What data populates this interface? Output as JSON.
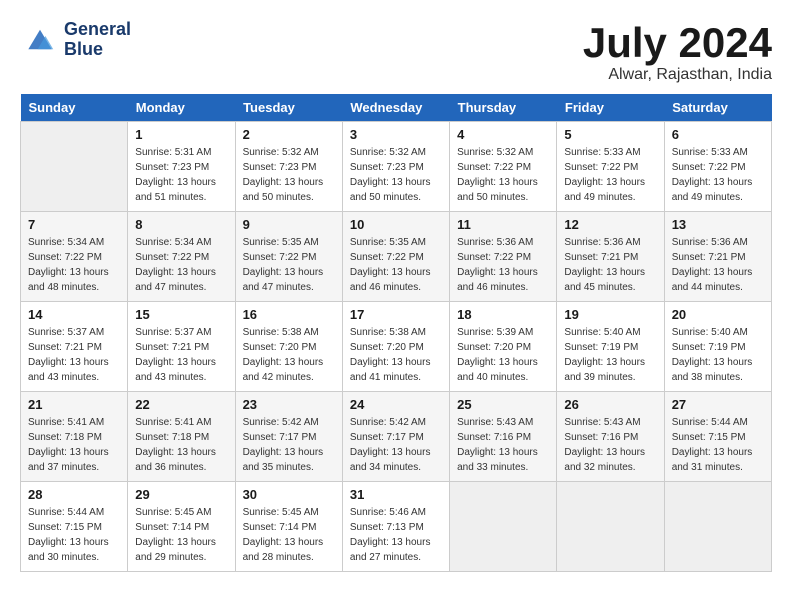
{
  "header": {
    "logo_line1": "General",
    "logo_line2": "Blue",
    "month": "July 2024",
    "location": "Alwar, Rajasthan, India"
  },
  "days_of_week": [
    "Sunday",
    "Monday",
    "Tuesday",
    "Wednesday",
    "Thursday",
    "Friday",
    "Saturday"
  ],
  "weeks": [
    [
      {
        "day": "",
        "sunrise": "",
        "sunset": "",
        "daylight": ""
      },
      {
        "day": "1",
        "sunrise": "Sunrise: 5:31 AM",
        "sunset": "Sunset: 7:23 PM",
        "daylight": "Daylight: 13 hours and 51 minutes."
      },
      {
        "day": "2",
        "sunrise": "Sunrise: 5:32 AM",
        "sunset": "Sunset: 7:23 PM",
        "daylight": "Daylight: 13 hours and 50 minutes."
      },
      {
        "day": "3",
        "sunrise": "Sunrise: 5:32 AM",
        "sunset": "Sunset: 7:23 PM",
        "daylight": "Daylight: 13 hours and 50 minutes."
      },
      {
        "day": "4",
        "sunrise": "Sunrise: 5:32 AM",
        "sunset": "Sunset: 7:22 PM",
        "daylight": "Daylight: 13 hours and 50 minutes."
      },
      {
        "day": "5",
        "sunrise": "Sunrise: 5:33 AM",
        "sunset": "Sunset: 7:22 PM",
        "daylight": "Daylight: 13 hours and 49 minutes."
      },
      {
        "day": "6",
        "sunrise": "Sunrise: 5:33 AM",
        "sunset": "Sunset: 7:22 PM",
        "daylight": "Daylight: 13 hours and 49 minutes."
      }
    ],
    [
      {
        "day": "7",
        "sunrise": "Sunrise: 5:34 AM",
        "sunset": "Sunset: 7:22 PM",
        "daylight": "Daylight: 13 hours and 48 minutes."
      },
      {
        "day": "8",
        "sunrise": "Sunrise: 5:34 AM",
        "sunset": "Sunset: 7:22 PM",
        "daylight": "Daylight: 13 hours and 47 minutes."
      },
      {
        "day": "9",
        "sunrise": "Sunrise: 5:35 AM",
        "sunset": "Sunset: 7:22 PM",
        "daylight": "Daylight: 13 hours and 47 minutes."
      },
      {
        "day": "10",
        "sunrise": "Sunrise: 5:35 AM",
        "sunset": "Sunset: 7:22 PM",
        "daylight": "Daylight: 13 hours and 46 minutes."
      },
      {
        "day": "11",
        "sunrise": "Sunrise: 5:36 AM",
        "sunset": "Sunset: 7:22 PM",
        "daylight": "Daylight: 13 hours and 46 minutes."
      },
      {
        "day": "12",
        "sunrise": "Sunrise: 5:36 AM",
        "sunset": "Sunset: 7:21 PM",
        "daylight": "Daylight: 13 hours and 45 minutes."
      },
      {
        "day": "13",
        "sunrise": "Sunrise: 5:36 AM",
        "sunset": "Sunset: 7:21 PM",
        "daylight": "Daylight: 13 hours and 44 minutes."
      }
    ],
    [
      {
        "day": "14",
        "sunrise": "Sunrise: 5:37 AM",
        "sunset": "Sunset: 7:21 PM",
        "daylight": "Daylight: 13 hours and 43 minutes."
      },
      {
        "day": "15",
        "sunrise": "Sunrise: 5:37 AM",
        "sunset": "Sunset: 7:21 PM",
        "daylight": "Daylight: 13 hours and 43 minutes."
      },
      {
        "day": "16",
        "sunrise": "Sunrise: 5:38 AM",
        "sunset": "Sunset: 7:20 PM",
        "daylight": "Daylight: 13 hours and 42 minutes."
      },
      {
        "day": "17",
        "sunrise": "Sunrise: 5:38 AM",
        "sunset": "Sunset: 7:20 PM",
        "daylight": "Daylight: 13 hours and 41 minutes."
      },
      {
        "day": "18",
        "sunrise": "Sunrise: 5:39 AM",
        "sunset": "Sunset: 7:20 PM",
        "daylight": "Daylight: 13 hours and 40 minutes."
      },
      {
        "day": "19",
        "sunrise": "Sunrise: 5:40 AM",
        "sunset": "Sunset: 7:19 PM",
        "daylight": "Daylight: 13 hours and 39 minutes."
      },
      {
        "day": "20",
        "sunrise": "Sunrise: 5:40 AM",
        "sunset": "Sunset: 7:19 PM",
        "daylight": "Daylight: 13 hours and 38 minutes."
      }
    ],
    [
      {
        "day": "21",
        "sunrise": "Sunrise: 5:41 AM",
        "sunset": "Sunset: 7:18 PM",
        "daylight": "Daylight: 13 hours and 37 minutes."
      },
      {
        "day": "22",
        "sunrise": "Sunrise: 5:41 AM",
        "sunset": "Sunset: 7:18 PM",
        "daylight": "Daylight: 13 hours and 36 minutes."
      },
      {
        "day": "23",
        "sunrise": "Sunrise: 5:42 AM",
        "sunset": "Sunset: 7:17 PM",
        "daylight": "Daylight: 13 hours and 35 minutes."
      },
      {
        "day": "24",
        "sunrise": "Sunrise: 5:42 AM",
        "sunset": "Sunset: 7:17 PM",
        "daylight": "Daylight: 13 hours and 34 minutes."
      },
      {
        "day": "25",
        "sunrise": "Sunrise: 5:43 AM",
        "sunset": "Sunset: 7:16 PM",
        "daylight": "Daylight: 13 hours and 33 minutes."
      },
      {
        "day": "26",
        "sunrise": "Sunrise: 5:43 AM",
        "sunset": "Sunset: 7:16 PM",
        "daylight": "Daylight: 13 hours and 32 minutes."
      },
      {
        "day": "27",
        "sunrise": "Sunrise: 5:44 AM",
        "sunset": "Sunset: 7:15 PM",
        "daylight": "Daylight: 13 hours and 31 minutes."
      }
    ],
    [
      {
        "day": "28",
        "sunrise": "Sunrise: 5:44 AM",
        "sunset": "Sunset: 7:15 PM",
        "daylight": "Daylight: 13 hours and 30 minutes."
      },
      {
        "day": "29",
        "sunrise": "Sunrise: 5:45 AM",
        "sunset": "Sunset: 7:14 PM",
        "daylight": "Daylight: 13 hours and 29 minutes."
      },
      {
        "day": "30",
        "sunrise": "Sunrise: 5:45 AM",
        "sunset": "Sunset: 7:14 PM",
        "daylight": "Daylight: 13 hours and 28 minutes."
      },
      {
        "day": "31",
        "sunrise": "Sunrise: 5:46 AM",
        "sunset": "Sunset: 7:13 PM",
        "daylight": "Daylight: 13 hours and 27 minutes."
      },
      {
        "day": "",
        "sunrise": "",
        "sunset": "",
        "daylight": ""
      },
      {
        "day": "",
        "sunrise": "",
        "sunset": "",
        "daylight": ""
      },
      {
        "day": "",
        "sunrise": "",
        "sunset": "",
        "daylight": ""
      }
    ]
  ]
}
